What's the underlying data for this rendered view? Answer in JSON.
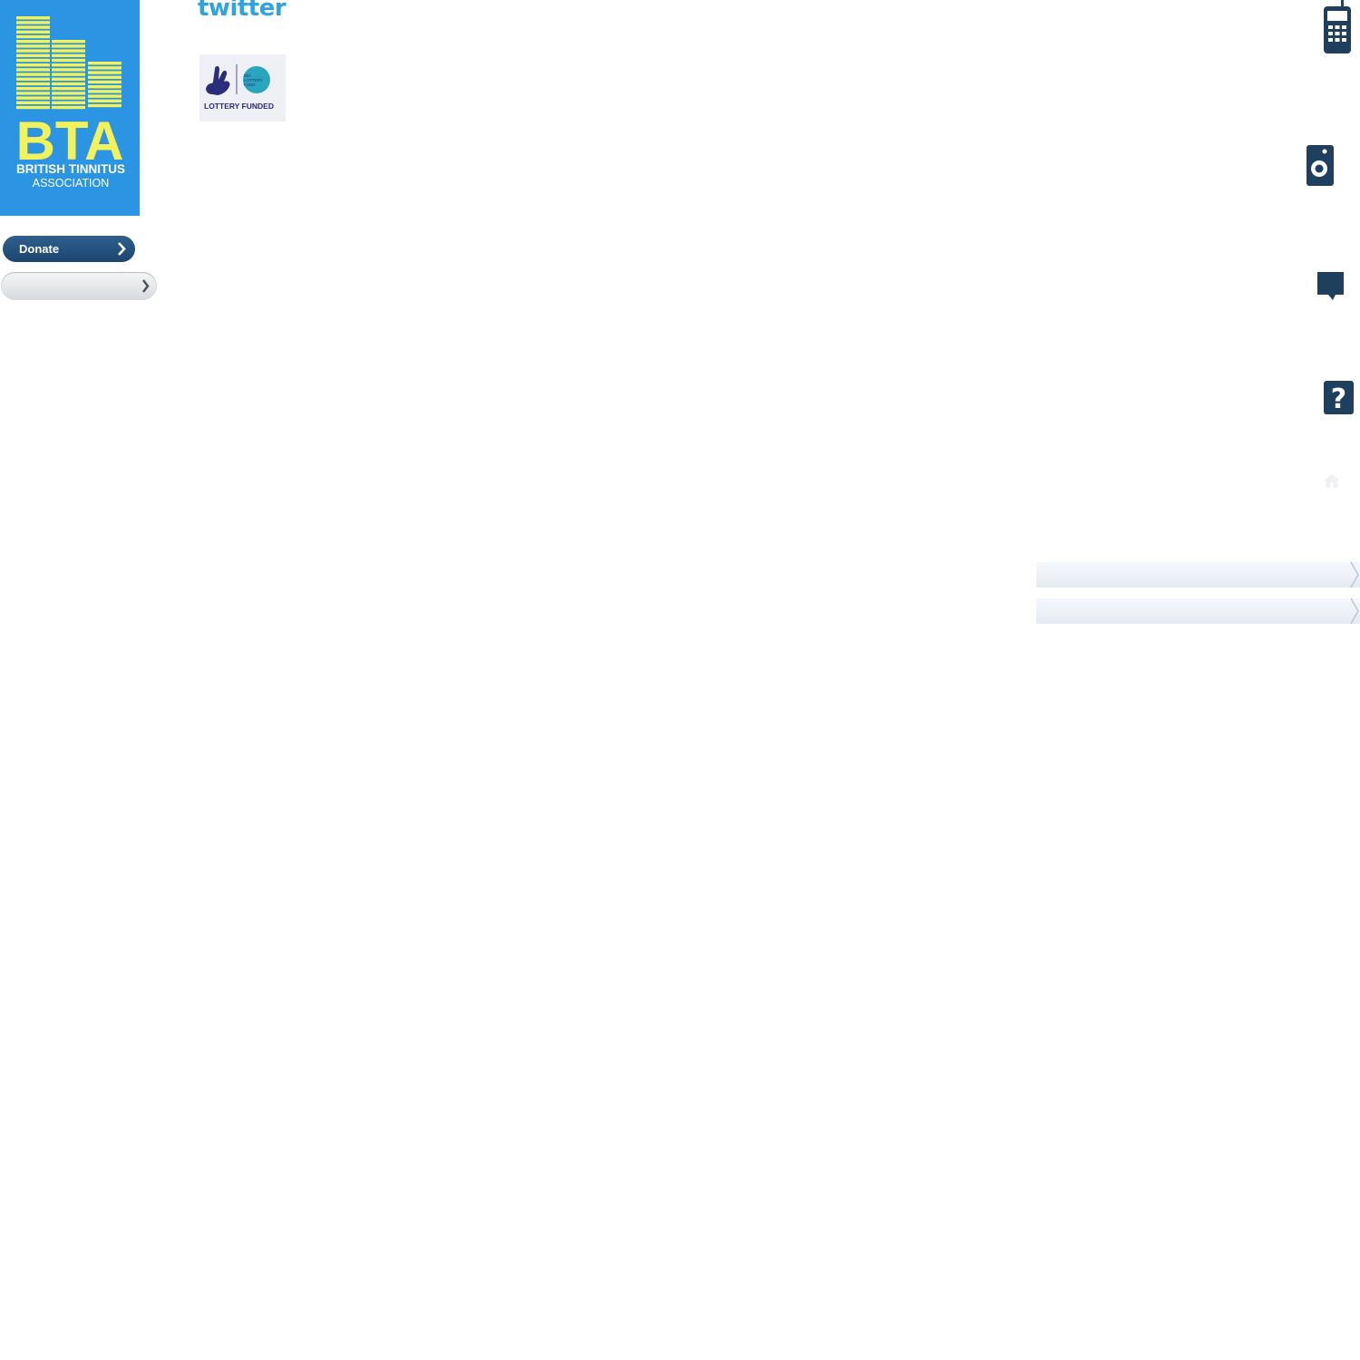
{
  "logo": {
    "initials": "BTA",
    "line1": "BRITISH TINNITUS",
    "line2": "ASSOCIATION",
    "bg_color": "#2b95e4",
    "fg_color": "#f4f25a"
  },
  "twitter": {
    "text": "twitter"
  },
  "lottery": {
    "label": "LOTTERY FUNDED",
    "sub": "BIG LOTTERY FUND"
  },
  "donate": {
    "label": "Donate"
  },
  "icons": [
    "phone-icon",
    "speaker-icon",
    "speech-bubble-icon",
    "question-icon",
    "home-icon"
  ]
}
